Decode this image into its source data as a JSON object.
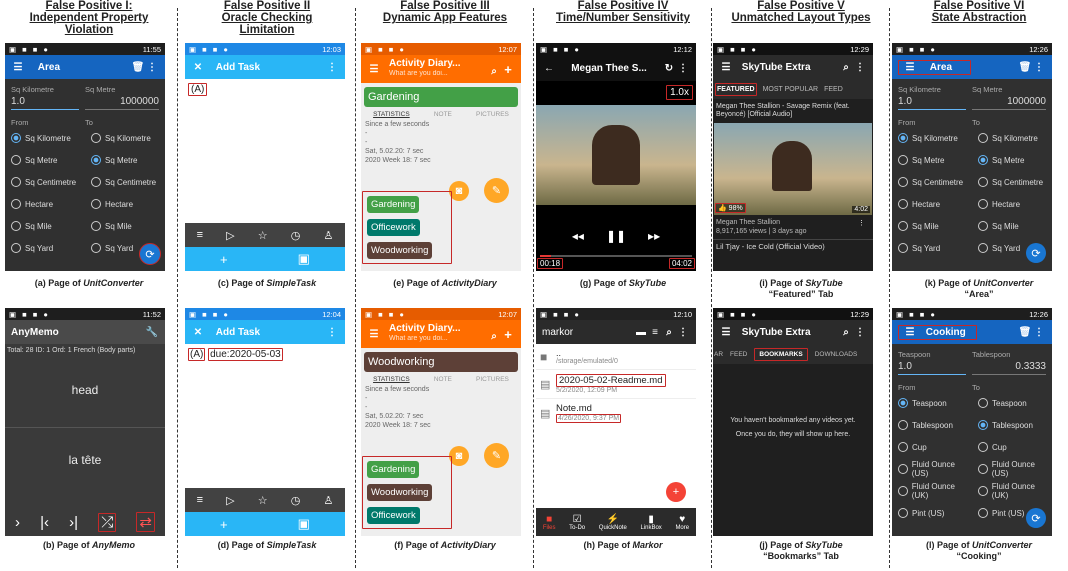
{
  "headers": [
    {
      "t1": "False Positive I:",
      "t2": "Independent Property",
      "t3": "Violation"
    },
    {
      "t1": "False Positive II",
      "t2": "Oracle Checking",
      "t3": "Limitation"
    },
    {
      "t1": "False Positive III",
      "t2": "Dynamic App Features",
      "t3": ""
    },
    {
      "t1": "False Positive IV",
      "t2": "Time/Number Sensitivity",
      "t3": ""
    },
    {
      "t1": "False Positive V",
      "t2": "Unmatched Layout Types",
      "t3": ""
    },
    {
      "t1": "False Positive VI",
      "t2": "State Abstraction",
      "t3": ""
    }
  ],
  "captions": {
    "a": {
      "pre": "(a) Page of ",
      "app": "UnitConverter",
      "line2": ""
    },
    "b": {
      "pre": "(b) Page of ",
      "app": "AnyMemo",
      "line2": ""
    },
    "c": {
      "pre": "(c) Page of ",
      "app": "SimpleTask",
      "line2": ""
    },
    "d": {
      "pre": "(d) Page of ",
      "app": "SimpleTask",
      "line2": ""
    },
    "e": {
      "pre": "(e) Page of ",
      "app": "ActivityDiary",
      "line2": ""
    },
    "f": {
      "pre": "(f) Page of ",
      "app": "ActivityDiary",
      "line2": ""
    },
    "g": {
      "pre": "(g) Page of ",
      "app": "SkyTube",
      "line2": ""
    },
    "h": {
      "pre": "(h) Page of ",
      "app": "Markor",
      "line2": ""
    },
    "i": {
      "pre": "(i) Page of ",
      "app": "SkyTube",
      "line2": "“Featured” Tab"
    },
    "j": {
      "pre": "(j) Page of ",
      "app": "SkyTube",
      "line2": "“Bookmarks” Tab"
    },
    "k": {
      "pre": "(k) Page of ",
      "app": "UnitConverter",
      "line2": "“Area”"
    },
    "l": {
      "pre": "(l) Page of ",
      "app": "UnitConverter",
      "line2": "“Cooking”"
    }
  },
  "a": {
    "time": "11:55",
    "title": "Area",
    "lf": "Sq Kilometre",
    "rf": "Sq Metre",
    "lv": "1.0",
    "rv": "1000000",
    "from": "From",
    "to": "To",
    "units": [
      "Sq Kilometre",
      "Sq Metre",
      "Sq Centimetre",
      "Hectare",
      "Sq Mile",
      "Sq Yard"
    ],
    "fromSel": 0,
    "toSel": 1
  },
  "b": {
    "time": "11:52",
    "title": "AnyMemo",
    "info": "Total: 28 ID: 1 Ord: 1 French (Body parts)",
    "q": "head",
    "ans": "la tête"
  },
  "c": {
    "time": "12:03",
    "title": "Add Task",
    "text": "(A)"
  },
  "d": {
    "time": "12:04",
    "title": "Add Task",
    "text": "(A)",
    "due": "due:2020-05-03"
  },
  "e": {
    "time": "12:07",
    "title": "Activity Diary...",
    "sub": "What are you doi...",
    "current": "Gardening",
    "tabs": [
      "STATISTICS",
      "NOTE",
      "PICTURES"
    ],
    "s1": "Since a few seconds",
    "s2": "-",
    "s3": "Sat, 5.02.20: 7 sec",
    "s4": "2020 Week 18: 7 sec",
    "tags": [
      "Gardening",
      "Officework",
      "Woodworking"
    ]
  },
  "f": {
    "time": "12:07",
    "title": "Activity Diary...",
    "sub": "What are you doi...",
    "current": "Woodworking",
    "tabs": [
      "STATISTICS",
      "NOTE",
      "PICTURES"
    ],
    "s1": "Since a few seconds",
    "s2": "-",
    "s3": "Sat, 5.02.20: 7 sec",
    "s4": "2020 Week 18: 7 sec",
    "tags": [
      "Gardening",
      "Woodworking",
      "Officework"
    ]
  },
  "g": {
    "time": "12:12",
    "title": "Megan Thee S...",
    "speed": "1.0x",
    "cur": "00:18",
    "dur": "04:02"
  },
  "h": {
    "time": "12:10",
    "title": "markor",
    "up": "..",
    "path": "/storage/emulated/0",
    "f1": "2020-05-02-Readme.md",
    "d1": "5/2/2020, 12:09 PM",
    "f2": "Note.md",
    "d2": "4/26/2020, 9:37 PM",
    "nav": [
      "Files",
      "To-Do",
      "QuickNote",
      "LinkBox",
      "More"
    ]
  },
  "i": {
    "time": "12:29",
    "title": "SkyTube Extra",
    "tabs": [
      "FEATURED",
      "MOST POPULAR",
      "FEED"
    ],
    "vtitle": "Megan Thee Stallion - Savage Remix (feat. Beyoncé) [Official Audio]",
    "likes": "98%",
    "vdur": "4:02",
    "chan": "Megan Thee Stallion",
    "meta": "8,917,165 views  |  3 days ago",
    "next": "Lil Tjay - Ice Cold (Official Video)"
  },
  "j": {
    "time": "12:29",
    "title": "SkyTube Extra",
    "tabs": [
      "AR",
      "FEED",
      "BOOKMARKS",
      "DOWNLOADS"
    ],
    "m1": "You haven't bookmarked any videos yet.",
    "m2": "Once you do, they will show up here."
  },
  "k": {
    "time": "12:26",
    "title": "Area",
    "lf": "Sq Kilometre",
    "rf": "Sq Metre",
    "lv": "1.0",
    "rv": "1000000",
    "from": "From",
    "to": "To",
    "units": [
      "Sq Kilometre",
      "Sq Metre",
      "Sq Centimetre",
      "Hectare",
      "Sq Mile",
      "Sq Yard"
    ],
    "fromSel": 0,
    "toSel": 1
  },
  "l": {
    "time": "12:26",
    "title": "Cooking",
    "lf": "Teaspoon",
    "rf": "Tablespoon",
    "lv": "1.0",
    "rv": "0.3333",
    "from": "From",
    "to": "To",
    "units": [
      "Teaspoon",
      "Tablespoon",
      "Cup",
      "Fluid Ounce (US)",
      "Fluid Ounce (UK)",
      "Pint (US)"
    ],
    "fromSel": 0,
    "toSel": 1
  }
}
